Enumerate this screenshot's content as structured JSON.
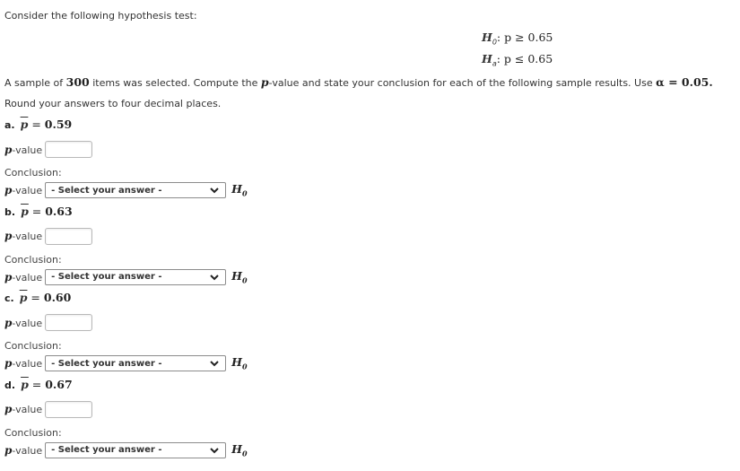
{
  "intro": "Consider the following hypothesis test:",
  "hypotheses": {
    "null": {
      "symbol": "H",
      "sub": "0",
      "relation": ": p ≥ 0.65"
    },
    "alt": {
      "symbol": "H",
      "sub": "a",
      "relation": ": p ≤ 0.65"
    }
  },
  "sample_text": {
    "before": "A sample of ",
    "n": "300",
    "middle": " items was selected. Compute the ",
    "p": "p",
    "after": "-value and state your conclusion for each of the following sample results. Use ",
    "alpha": "α = 0.05",
    "end": "."
  },
  "round_text": "Round your answers to four decimal places.",
  "labels": {
    "p": "p",
    "pvalue_suffix": "-value",
    "conclusion": "Conclusion:",
    "h0_symbol": "H",
    "h0_sub": "0",
    "pbar": "p",
    "equals": " = "
  },
  "parts": [
    {
      "letter": "a.",
      "value": "0.59",
      "pvalue_input": "",
      "select_value": "- Select your answer -"
    },
    {
      "letter": "b.",
      "value": "0.63",
      "pvalue_input": "",
      "select_value": "- Select your answer -"
    },
    {
      "letter": "c.",
      "value": "0.60",
      "pvalue_input": "",
      "select_value": "- Select your answer -"
    },
    {
      "letter": "d.",
      "value": "0.67",
      "pvalue_input": "",
      "select_value": "- Select your answer -"
    }
  ]
}
